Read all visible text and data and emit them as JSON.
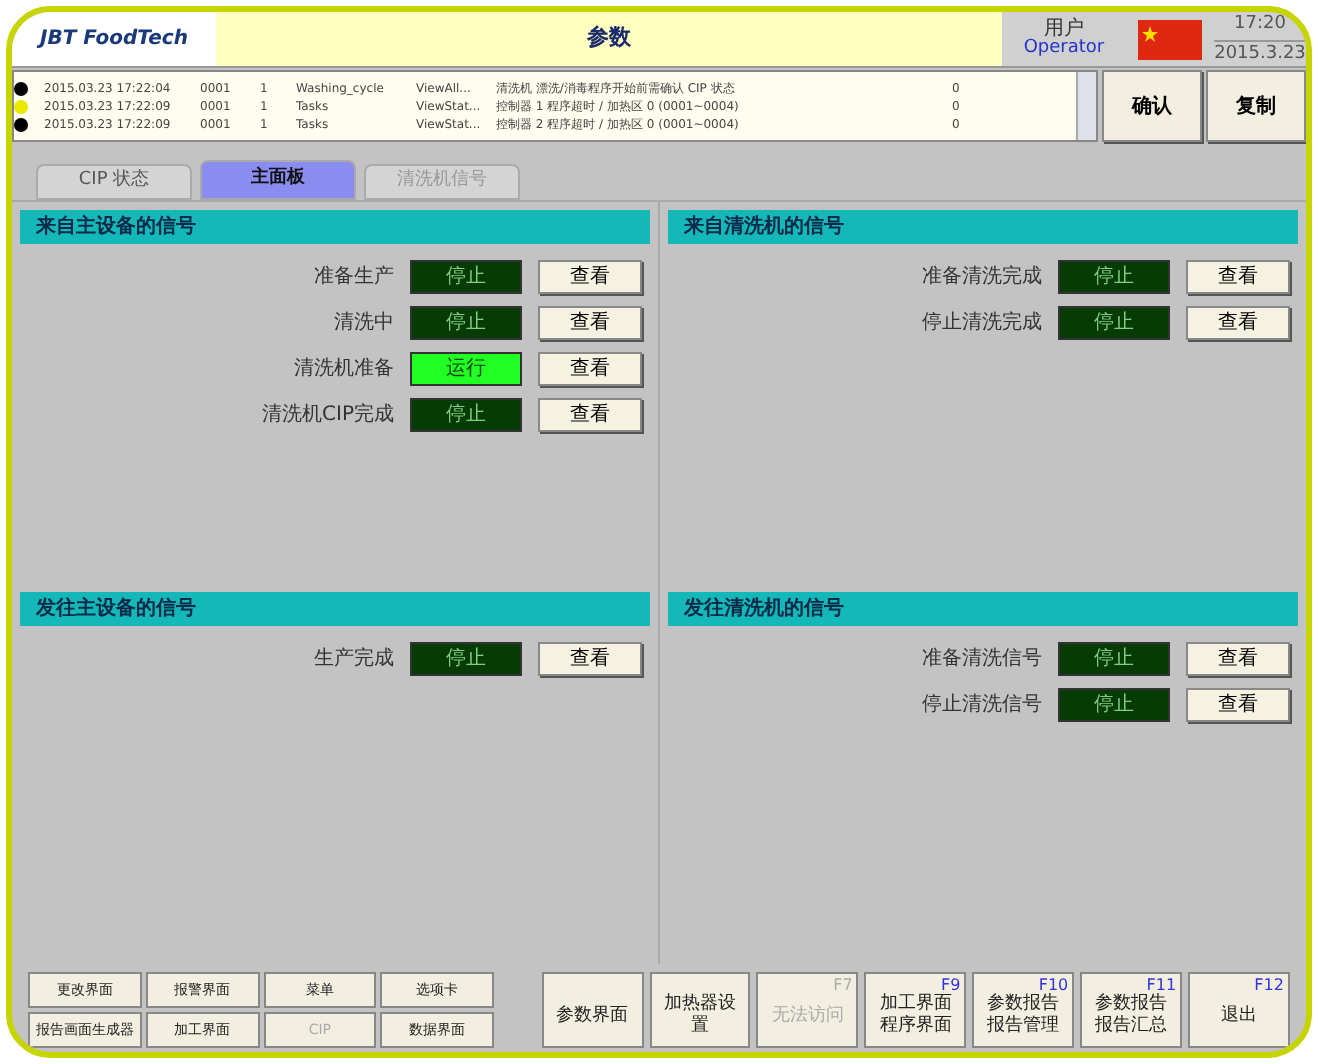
{
  "header": {
    "logo": "JBT FoodTech",
    "title": "参数",
    "user_label": "用户",
    "user": "Operator",
    "time": "17:20",
    "date": "2015.3.23"
  },
  "messages": [
    {
      "color": "#000000",
      "date": "2015.03.23 17:22:04",
      "code": "0001",
      "num": "1",
      "source": "Washing_cycle",
      "view": "ViewAll...",
      "text": "清洗机 漂洗/消毒程序开始前需确认 CIP 状态",
      "count": "0"
    },
    {
      "color": "#e8e800",
      "date": "2015.03.23 17:22:09",
      "code": "0001",
      "num": "1",
      "source": "Tasks",
      "view": "ViewStat...",
      "text": "控制器 1 程序超时 / 加热区 0 (0001~0004)",
      "count": "0"
    },
    {
      "color": "#000000",
      "date": "2015.03.23 17:22:09",
      "code": "0001",
      "num": "1",
      "source": "Tasks",
      "view": "ViewStat...",
      "text": "控制器 2 程序超时 / 加热区 0 (0001~0004)",
      "count": "0"
    }
  ],
  "message_buttons": [
    "确认",
    "复制"
  ],
  "tabs": [
    {
      "label": "CIP 状态",
      "selected": false,
      "disabled": false
    },
    {
      "label": "主面板",
      "selected": true,
      "disabled": false
    },
    {
      "label": "清洗机信号",
      "selected": false,
      "disabled": true
    }
  ],
  "panels": [
    {
      "title": "来自主设备的信号",
      "signals": [
        {
          "label": "准备生产",
          "value": "停止",
          "on": false,
          "button": "查看"
        },
        {
          "label": "清洗中",
          "value": "停止",
          "on": false,
          "button": "查看"
        },
        {
          "label": "清洗机准备",
          "value": "运行",
          "on": true,
          "button": "查看"
        },
        {
          "label": "清洗机CIP完成",
          "value": "停止",
          "on": false,
          "button": "查看"
        }
      ]
    },
    {
      "title": "来自清洗机的信号",
      "signals": [
        {
          "label": "准备清洗完成",
          "value": "停止",
          "on": false,
          "button": "查看"
        },
        {
          "label": "停止清洗完成",
          "value": "停止",
          "on": false,
          "button": "查看"
        }
      ]
    },
    {
      "title": "发往主设备的信号",
      "signals": [
        {
          "label": "生产完成",
          "value": "停止",
          "on": false,
          "button": "查看"
        }
      ]
    },
    {
      "title": "发往清洗机的信号",
      "signals": [
        {
          "label": "准备清洗信号",
          "value": "停止",
          "on": false,
          "button": "查看"
        },
        {
          "label": "停止清洗信号",
          "value": "停止",
          "on": false,
          "button": "查看"
        }
      ]
    }
  ],
  "nav_buttons": [
    {
      "label": "更改界面",
      "disabled": false
    },
    {
      "label": "报警界面",
      "disabled": false
    },
    {
      "label": "菜单",
      "disabled": false
    },
    {
      "label": "选项卡",
      "disabled": false
    },
    {
      "label": "报告画面生成器",
      "disabled": false
    },
    {
      "label": "加工界面",
      "disabled": false
    },
    {
      "label": "CIP",
      "disabled": true
    },
    {
      "label": "数据界面",
      "disabled": false
    }
  ],
  "function_keys": [
    {
      "label": "参数界面",
      "disabled": false
    },
    {
      "label": "加热器设置",
      "disabled": false
    },
    {
      "label": "无法访问",
      "key": "F7",
      "disabled": true
    },
    {
      "label": "加工界面程序界面",
      "key": "F9",
      "disabled": false
    },
    {
      "label": "参数报告报告管理",
      "key": "F10",
      "disabled": false
    },
    {
      "label": "参数报告报告汇总",
      "key": "F11",
      "disabled": false
    },
    {
      "label": "退出",
      "key": "F12",
      "disabled": false
    }
  ]
}
